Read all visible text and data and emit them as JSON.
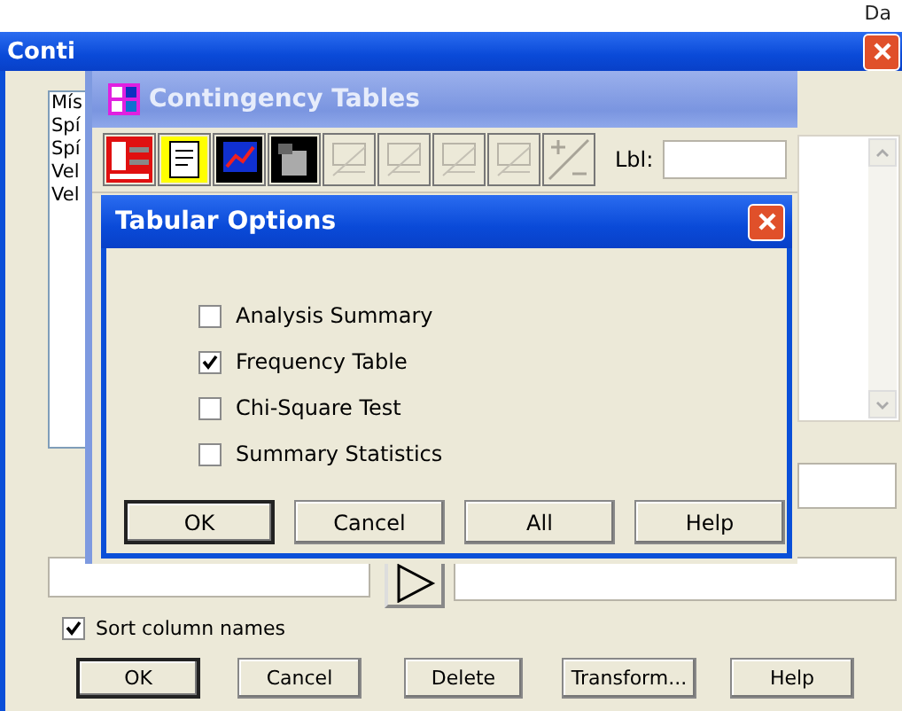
{
  "corner_text": "Da",
  "back_window": {
    "title": "Conti",
    "list_items": [
      "Mís",
      "Spí",
      "Spí",
      "Vel",
      "Vel"
    ],
    "sort_option": {
      "label": "Sort column names",
      "checked": true
    },
    "buttons": [
      "OK",
      "Cancel",
      "Delete",
      "Transform...",
      "Help"
    ]
  },
  "middle_window": {
    "title": "Contingency Tables",
    "label_caption": "Lbl:"
  },
  "dialog": {
    "title": "Tabular Options",
    "options": [
      {
        "label": "Analysis Summary",
        "checked": false
      },
      {
        "label": "Frequency Table",
        "checked": true
      },
      {
        "label": "Chi-Square Test",
        "checked": false
      },
      {
        "label": "Summary Statistics",
        "checked": false
      }
    ],
    "buttons": [
      "OK",
      "Cancel",
      "All",
      "Help"
    ]
  }
}
